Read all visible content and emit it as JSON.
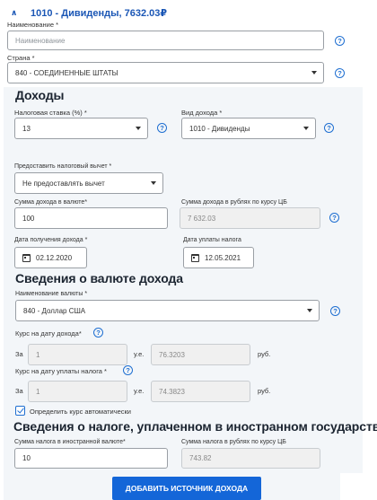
{
  "header": {
    "title": "1010 - Дивиденды, 7632.03₽"
  },
  "name_field": {
    "label": "Наименование *",
    "placeholder": "Наименование"
  },
  "country_field": {
    "label": "Страна *",
    "value": "840 - СОЕДИНЕННЫЕ ШТАТЫ"
  },
  "income_section": {
    "title": "Доходы",
    "tax_rate": {
      "label": "Налоговая ставка (%) *",
      "value": "13"
    },
    "income_type": {
      "label": "Вид дохода *",
      "value": "1010 - Дивиденды"
    },
    "deduction": {
      "label": "Предоставить налоговый вычет *",
      "value": "Не предоставлять вычет"
    },
    "amount_currency": {
      "label": "Сумма дохода в валюте*",
      "value": "100"
    },
    "amount_rub": {
      "label": "Сумма дохода в рублях по курсу ЦБ",
      "value": "7 632.03"
    },
    "income_date": {
      "label": "Дата получения дохода *",
      "value": "02.12.2020"
    },
    "tax_date": {
      "label": "Дата уплаты налога",
      "value": "12.05.2021"
    }
  },
  "currency_section": {
    "title": "Сведения о валюте дохода",
    "currency_name": {
      "label": "Наименование валюты *",
      "value": "840 - Доллар США"
    },
    "rate_income": {
      "label": "Курс на дату дохода*",
      "za": "За",
      "units": "1",
      "ue": "у.е.",
      "rate": "76.3203",
      "rub": "руб."
    },
    "rate_tax": {
      "label": "Курс на дату уплаты налога *",
      "za": "За",
      "units": "1",
      "ue": "у.е.",
      "rate": "74.3823",
      "rub": "руб."
    },
    "auto_rate": {
      "label": "Определить курс автоматически",
      "checked": true
    }
  },
  "foreign_tax_section": {
    "title": "Сведения о налоге, уплаченном в иностранном государстве",
    "tax_currency": {
      "label": "Сумма налога в иностранной валюте*",
      "value": "10"
    },
    "tax_rub": {
      "label": "Сумма налога в рублях по курсу ЦБ",
      "value": "743.82"
    }
  },
  "actions": {
    "add_source": "ДОБАВИТЬ ИСТОЧНИК ДОХОДА"
  },
  "icons": {
    "help": "?"
  }
}
